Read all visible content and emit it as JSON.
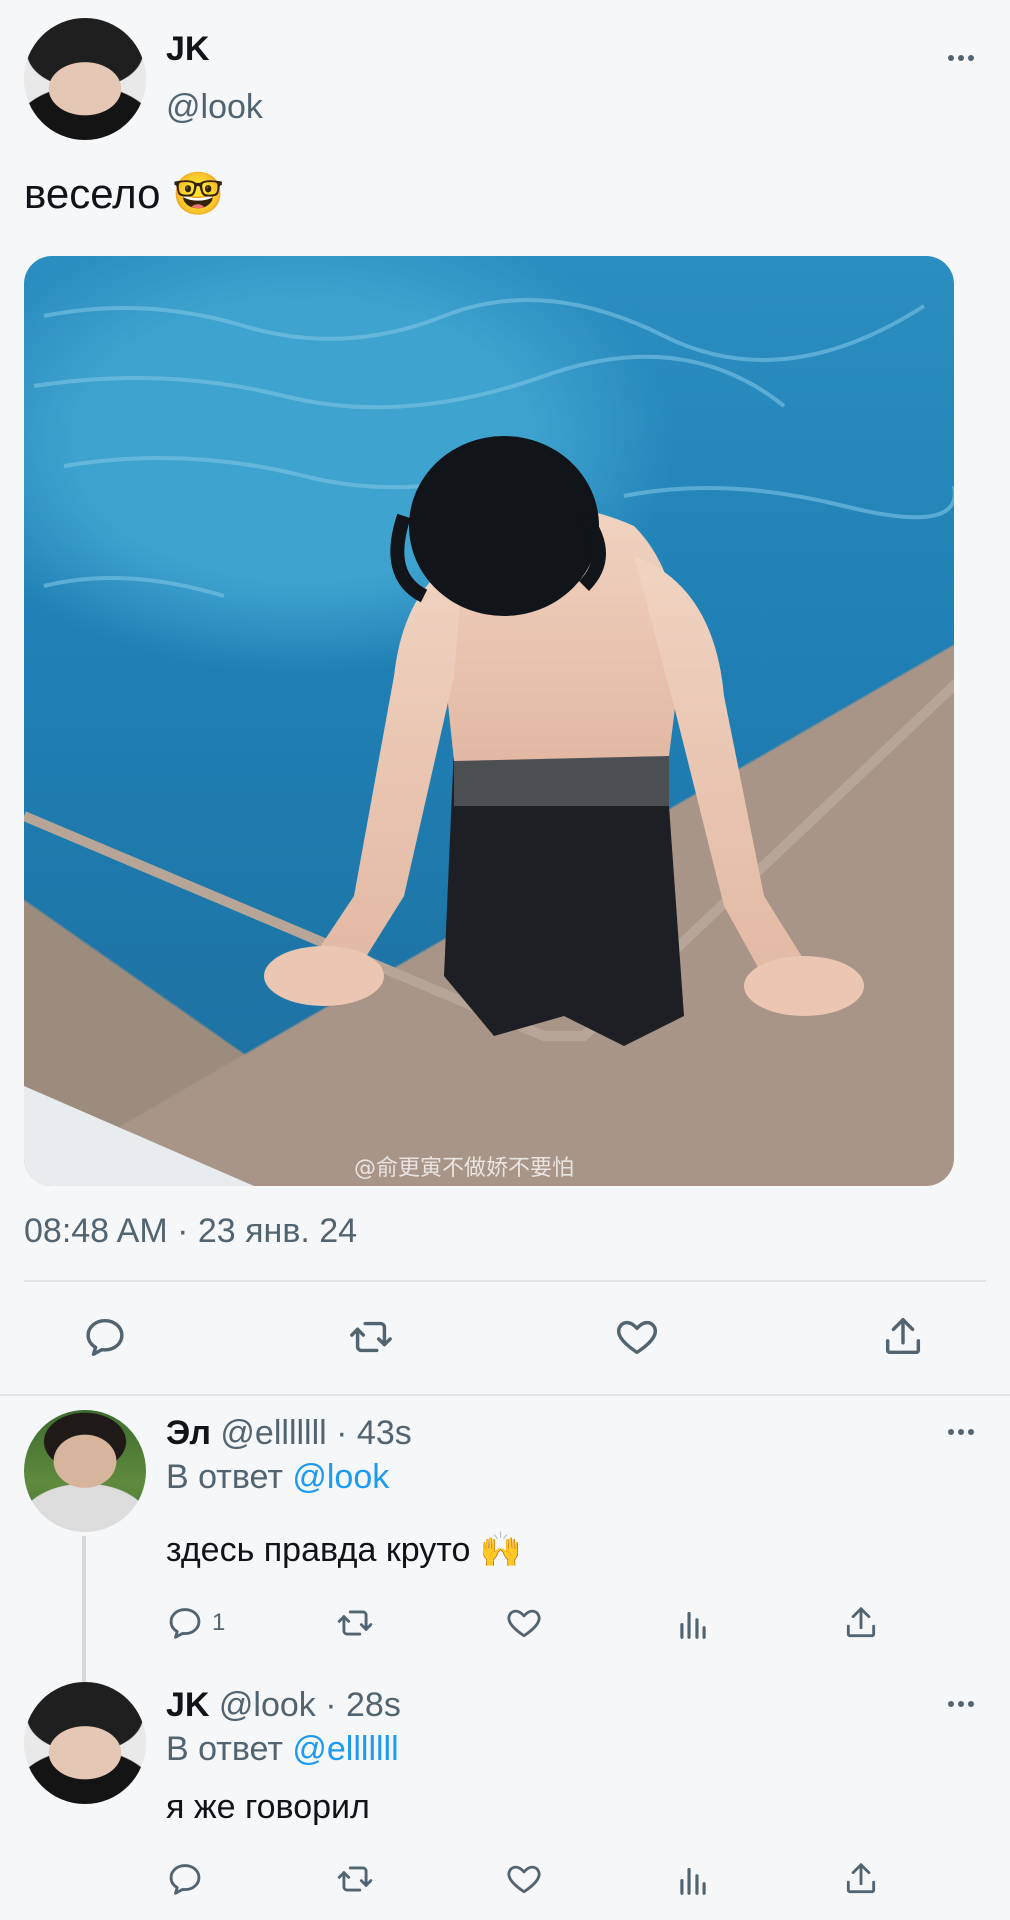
{
  "tweet": {
    "author_name": "JK",
    "author_handle": "@look",
    "text": "весело 🤓",
    "photo_watermark": "@俞更寅不做娇不要怕",
    "timestamp": "08:48 AM · 23 янв. 24"
  },
  "replies": [
    {
      "author_name": "Эл",
      "meta": "@elllllll · 43s",
      "reply_prefix": "В ответ",
      "reply_to": "@look",
      "text": "здесь правда круто 🙌",
      "reply_count": "1"
    },
    {
      "author_name": "JK",
      "meta": "@look · 28s",
      "reply_prefix": "В ответ",
      "reply_to": "@elllllll",
      "text": "я же говорил"
    }
  ],
  "icons": {
    "more": "more-icon",
    "reply": "reply-icon",
    "retweet": "retweet-icon",
    "like": "heart-icon",
    "views": "views-icon",
    "share": "share-icon"
  },
  "colors": {
    "background": "#f6f7f9",
    "accent": "#1d9bf0",
    "text": "#0f1419",
    "muted": "#536471"
  }
}
